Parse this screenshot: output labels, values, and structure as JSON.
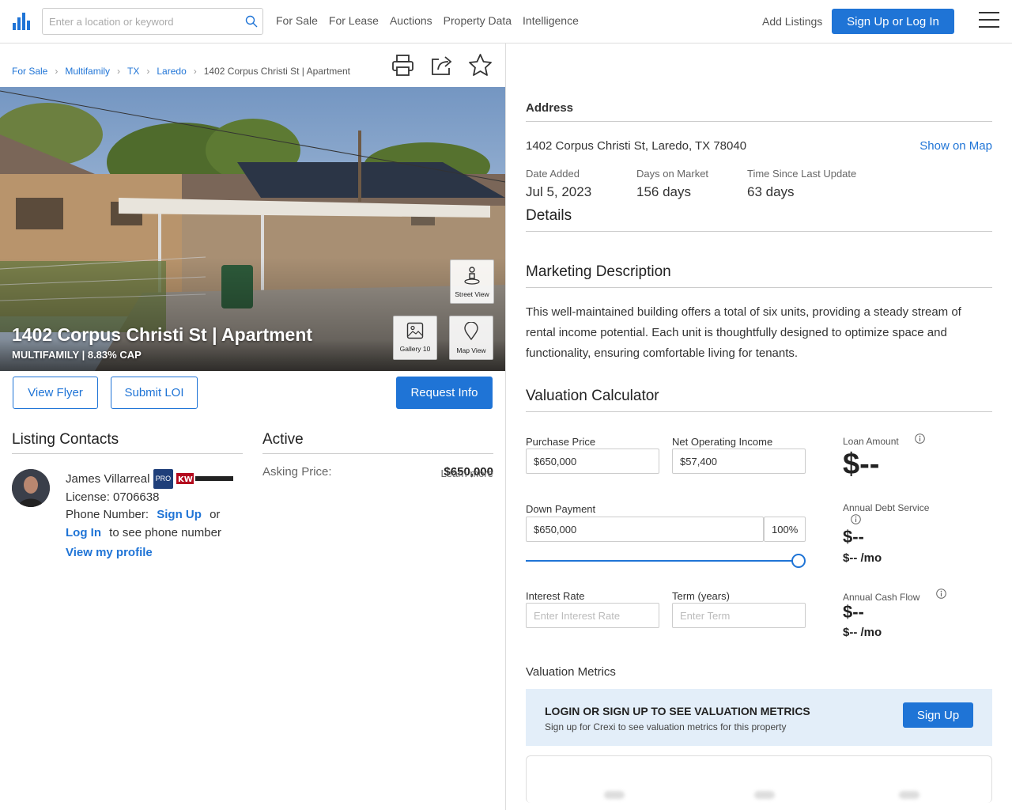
{
  "header": {
    "search_placeholder": "Enter a location or keyword",
    "nav": [
      "For Sale",
      "For Lease",
      "Auctions",
      "Property Data",
      "Intelligence"
    ],
    "add_listings": "Add Listings",
    "signup_login": "Sign Up or Log In"
  },
  "breadcrumb": [
    "For Sale",
    "Multifamily",
    "TX",
    "Laredo",
    "1402 Corpus Christi St | Apartment"
  ],
  "hero": {
    "title": "1402 Corpus Christi St | Apartment",
    "subtitle": "MULTIFAMILY | 8.83% CAP",
    "street_view": "Street View",
    "gallery": "Gallery 10",
    "map_view": "Map View"
  },
  "actions": {
    "view_flyer": "View Flyer",
    "submit_loi": "Submit LOI",
    "request_info": "Request Info"
  },
  "contacts": {
    "heading": "Listing Contacts",
    "name": "James Villarreal",
    "pro": "PRO",
    "license": "License: 0706638",
    "phone_label": "Phone Number:",
    "sign_up": "Sign Up",
    "or": "or",
    "log_in": "Log In",
    "to_see": "to see phone number",
    "view_profile": "View my profile"
  },
  "status": {
    "heading": "Active",
    "asking_label": "Asking Price:",
    "asking_value": "$650,000",
    "learn_more": "Learn more"
  },
  "address": {
    "heading": "Address",
    "full": "1402 Corpus Christi St, Laredo, TX 78040",
    "show_map": "Show on Map"
  },
  "stats": [
    {
      "label": "Date Added",
      "value": "Jul 5, 2023"
    },
    {
      "label": "Days on Market",
      "value": "156 days"
    },
    {
      "label": "Time Since Last Update",
      "value": "63 days"
    }
  ],
  "details": {
    "heading": "Details"
  },
  "marketing": {
    "heading": "Marketing Description",
    "text": "This well-maintained building offers a total of six units, providing a steady stream of rental income potential. Each unit is thoughtfully designed to optimize space and functionality, ensuring comfortable living for tenants."
  },
  "calculator": {
    "heading": "Valuation Calculator",
    "purchase_price_label": "Purchase Price",
    "purchase_price": "$650,000",
    "noi_label": "Net Operating Income",
    "noi": "$57,400",
    "down_payment_label": "Down Payment",
    "down_payment": "$650,000",
    "down_pct": "100%",
    "down_slider_fraction": 1.0,
    "interest_label": "Interest Rate",
    "interest_placeholder": "Enter Interest Rate",
    "term_label": "Term (years)",
    "term_placeholder": "Enter Term",
    "loan_amount_label": "Loan Amount",
    "loan_amount": "$--",
    "debt_service_label": "Annual Debt Service",
    "debt_service": "$--",
    "debt_service_mo": "$-- /mo",
    "cash_flow_label": "Annual Cash Flow",
    "cash_flow": "$--",
    "cash_flow_mo": "$-- /mo"
  },
  "metrics": {
    "heading": "Valuation Metrics",
    "banner_title": "LOGIN OR SIGN UP TO SEE VALUATION METRICS",
    "banner_sub": "Sign up for Crexi to see valuation metrics for this property",
    "sign_up": "Sign Up"
  },
  "colors": {
    "accent": "#1f74d6",
    "banner_bg": "#e3eef9"
  }
}
